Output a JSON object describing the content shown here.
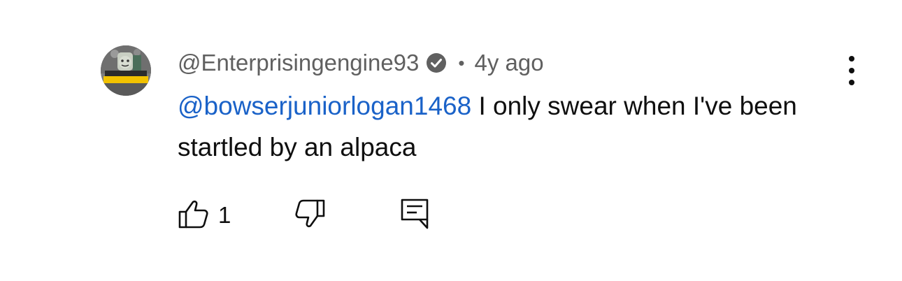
{
  "comment": {
    "author": "@Enterprisingengine93",
    "separator": "•",
    "timestamp": "4y ago",
    "mention": "@bowserjuniorlogan1468",
    "text": " I only swear when I've been startled by an alpaca",
    "like_count": "1",
    "verified": true
  },
  "icons": {
    "avatar": "train-avatar",
    "verified": "check-circle-icon",
    "menu": "more-vert-icon",
    "like": "thumb-up-icon",
    "dislike": "thumb-down-icon",
    "reply": "comment-reply-icon"
  },
  "colors": {
    "mention": "#1a62c8",
    "meta": "#606060",
    "text": "#0f0f0f"
  }
}
